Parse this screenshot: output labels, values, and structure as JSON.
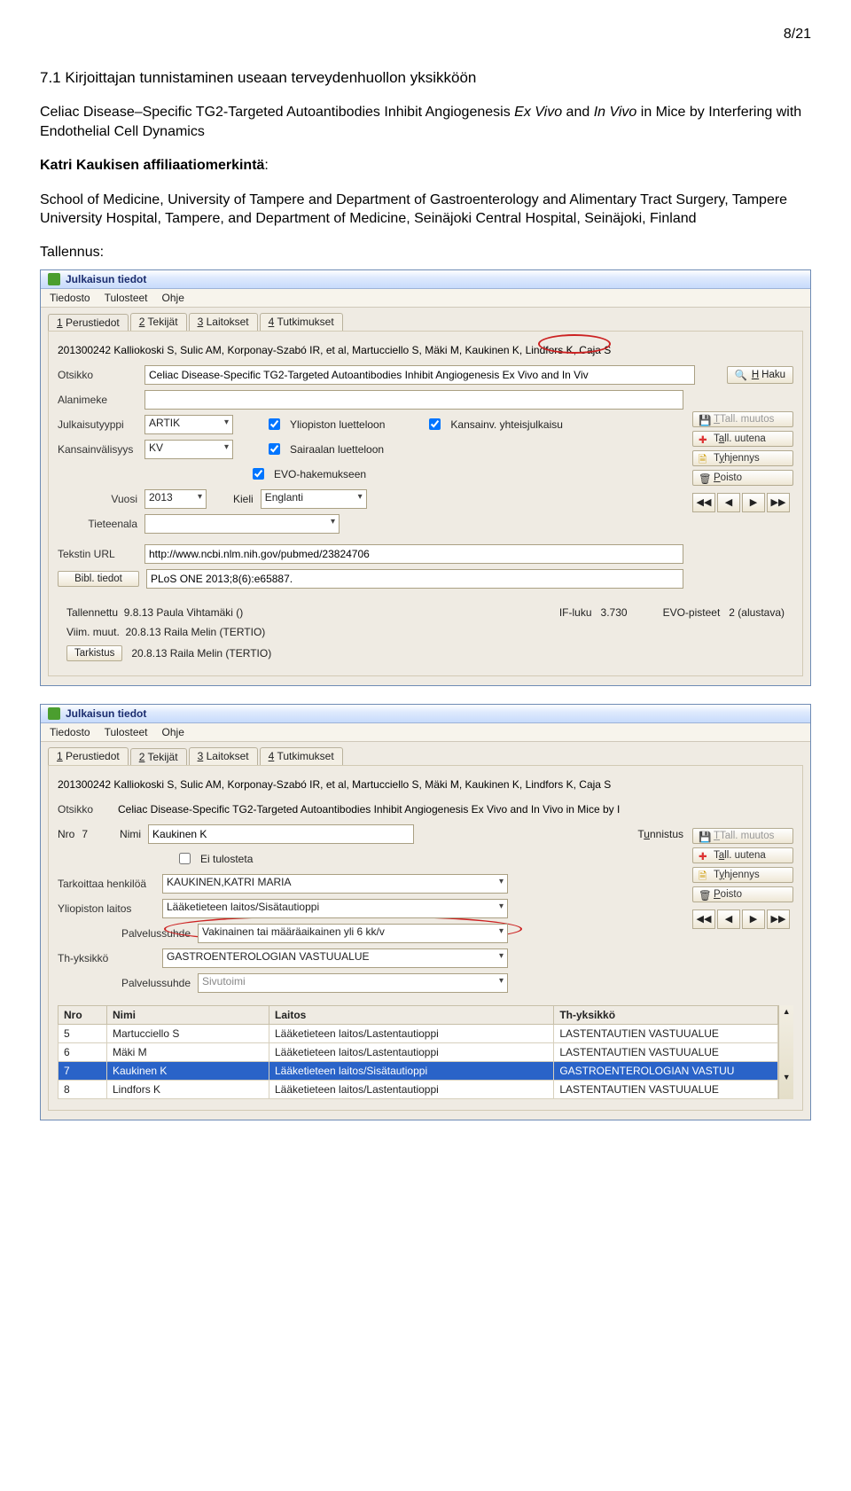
{
  "page_number": "8/21",
  "section_heading": "7.1 Kirjoittajan tunnistaminen useaan terveydenhuollon yksikköön",
  "article_title_plain": "Celiac Disease–Specific TG2-Targeted Autoantibodies Inhibit Angiogenesis ",
  "article_title_italic": "Ex Vivo",
  "article_title_mid": " and ",
  "article_title_italic2": "In Vivo",
  "article_title_tail": " in Mice by Interfering with Endothelial Cell Dynamics",
  "affil_label_bold": "Katri Kaukisen affiliaatiomerkintä",
  "affil_text": "School of Medicine, University of Tampere and Department of Gastroenterology and Alimentary Tract Surgery, Tampere University Hospital, Tampere, and Department of Medicine, Seinäjoki Central Hospital, Seinäjoki, Finland",
  "save_label": "Tallennus:",
  "win_title": "Julkaisun tiedot",
  "menu": {
    "file": "Tiedosto",
    "print": "Tulosteet",
    "help": "Ohje"
  },
  "tabs": {
    "t1": "Perustiedot",
    "t1u": "1",
    "t2": "Tekijät",
    "t2u": "2",
    "t3": "Laitokset",
    "t3u": "3",
    "t4": "Tutkimukset",
    "t4u": "4"
  },
  "win1": {
    "id_line": "201300242   Kalliokoski S, Sulic AM, Korponay-Szabó IR, et al, Martucciello S, Mäki M, Kaukinen K, Lindfors K, Caja S",
    "otsikko_lbl": "Otsikko",
    "otsikko_val": "Celiac Disease-Specific TG2-Targeted Autoantibodies Inhibit Angiogenesis Ex Vivo and In Viv",
    "haku": "Haku",
    "alanimeke_lbl": "Alanimeke",
    "alanimeke_val": "",
    "julkaisutyyppi_lbl": "Julkaisutyyppi",
    "julkaisutyyppi_val": "ARTIK",
    "kv_lbl": "Kansainvälisyys",
    "kv_val": "KV",
    "chk_yl": "Yliopiston luetteloon",
    "chk_sl": "Sairaalan luetteloon",
    "chk_eh": "EVO-hakemukseen",
    "chk_ky": "Kansainv. yhteisjulkaisu",
    "vuosi_lbl": "Vuosi",
    "vuosi_val": "2013",
    "kieli_lbl": "Kieli",
    "kieli_val": "Englanti",
    "tiet_lbl": "Tieteenala",
    "tiet_val": "",
    "url_lbl": "Tekstin URL",
    "url_val": "http://www.ncbi.nlm.nih.gov/pubmed/23824706",
    "bibl_btn": "Bibl. tiedot",
    "bibl_val": "PLoS ONE 2013;8(6):e65887.",
    "tall_lbl": "Tallennettu",
    "tall_val": "9.8.13 Paula Vihtamäki ()",
    "if_lbl": "IF-luku",
    "if_val": "3.730",
    "evo_lbl": "EVO-pisteet",
    "evo_val": "2 (alustava)",
    "vm_lbl": "Viim. muut.",
    "vm_val": "20.8.13 Raila Melin (TERTIO)",
    "tark_btn": "Tarkistus",
    "tark_val": "20.8.13 Raila Melin (TERTIO)"
  },
  "sidebtns": {
    "save": "Tall. muutos",
    "save_u": "T",
    "new": "Tall. uutena",
    "new_u": "a",
    "clear": "Tyhjennys",
    "clear_u": "y",
    "del": "Poisto",
    "del_u": "P"
  },
  "win2": {
    "id_line": "201300242   Kalliokoski S, Sulic AM, Korponay-Szabó IR, et al, Martucciello S, Mäki M, Kaukinen K, Lindfors K, Caja S",
    "otsikko_lbl": "Otsikko",
    "otsikko_val": "Celiac Disease-Specific TG2-Targeted Autoantibodies Inhibit Angiogenesis Ex Vivo and In Vivo in Mice by I",
    "nro_lbl": "Nro",
    "nro_val": "7",
    "nimi_lbl": "Nimi",
    "nimi_val": "Kaukinen K",
    "tunnistus_lbl": "Tunnistus",
    "tunnistus_u": "u",
    "eitul": "Ei tulosteta",
    "tarkh_lbl": "Tarkoittaa henkilöä",
    "tarkh_val": "KAUKINEN,KATRI MARIA",
    "yl_lbl": "Yliopiston laitos",
    "yl_val": "Lääketieteen laitos/Sisätautioppi",
    "ps_lbl": "Palvelussuhde",
    "ps_val": "Vakinainen tai määräaikainen yli 6 kk/v",
    "thy_lbl": "Th-yksikkö",
    "thy_val": "GASTROENTEROLOGIAN VASTUUALUE",
    "ps2_lbl": "Palvelussuhde",
    "ps2_val": "Sivutoimi",
    "table": {
      "h_nro": "Nro",
      "h_nimi": "Nimi",
      "h_laitos": "Laitos",
      "h_thy": "Th-yksikkö",
      "rows": [
        {
          "nro": "5",
          "nimi": "Martucciello S",
          "laitos": "Lääketieteen laitos/Lastentautioppi",
          "thy": "LASTENTAUTIEN VASTUUALUE"
        },
        {
          "nro": "6",
          "nimi": "Mäki M",
          "laitos": "Lääketieteen laitos/Lastentautioppi",
          "thy": "LASTENTAUTIEN VASTUUALUE"
        },
        {
          "nro": "7",
          "nimi": "Kaukinen K",
          "laitos": "Lääketieteen laitos/Sisätautioppi",
          "thy": "GASTROENTEROLOGIAN VASTUU"
        },
        {
          "nro": "8",
          "nimi": "Lindfors K",
          "laitos": "Lääketieteen laitos/Lastentautioppi",
          "thy": "LASTENTAUTIEN VASTUUALUE"
        }
      ]
    }
  }
}
